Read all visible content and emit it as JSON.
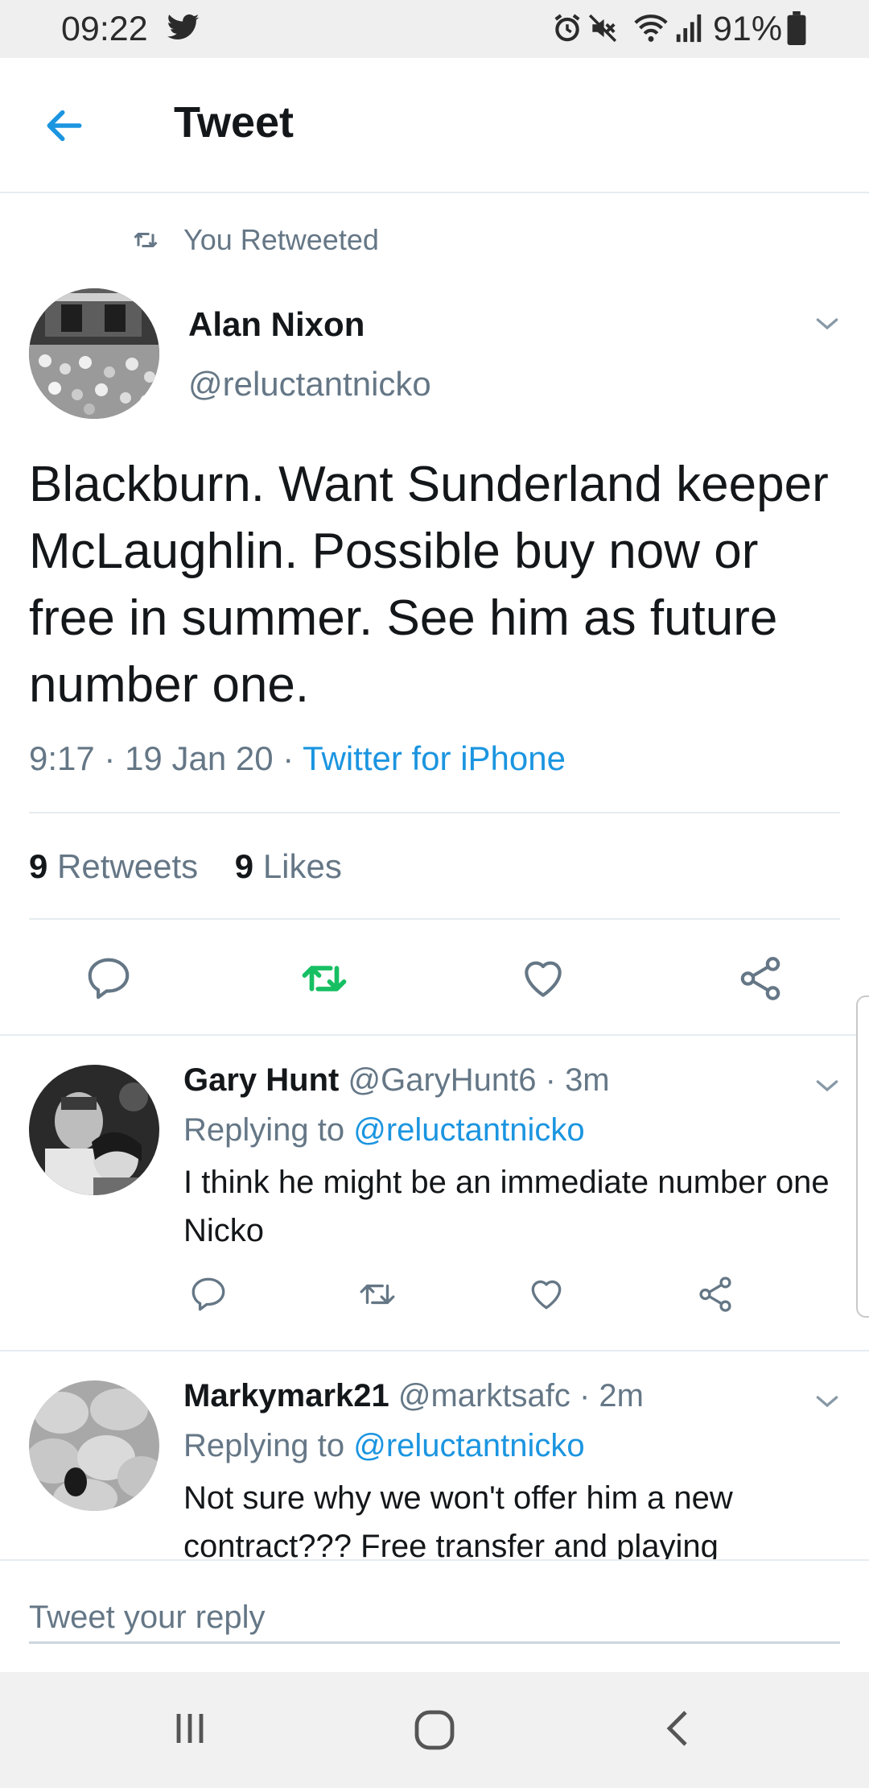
{
  "status_bar": {
    "time": "09:22",
    "battery": "91%",
    "icons": [
      "twitter-icon",
      "alarm-icon",
      "mute-icon",
      "wifi-icon",
      "signal-icon",
      "battery-icon"
    ]
  },
  "header": {
    "back_icon": "arrow-left-icon",
    "title": "Tweet"
  },
  "tweet": {
    "retweet_label": "You Retweeted",
    "author_name": "Alan Nixon",
    "author_handle": "@reluctantnicko",
    "text": "Blackburn. Want Sunderland keeper McLaughlin. Possible buy now or free in summer. See him as future number one.",
    "time": "9:17",
    "date": "19 Jan 20",
    "source": "Twitter for iPhone",
    "retweets_count": "9",
    "retweets_label": "Retweets",
    "likes_count": "9",
    "likes_label": "Likes",
    "retweeted": true
  },
  "replies": [
    {
      "name": "Gary Hunt",
      "handle": "@GaryHunt6",
      "age": "3m",
      "replying_prefix": "Replying to",
      "replying_to": "@reluctantnicko",
      "text": "I think he might be an immediate number one Nicko"
    },
    {
      "name": "Markymark21",
      "handle": "@marktsafc",
      "age": "2m",
      "replying_prefix": "Replying to",
      "replying_to": "@reluctantnicko",
      "text": "Not sure why we won't offer him a new contract??? Free transfer and playing"
    }
  ],
  "reply_bar": {
    "placeholder": "Tweet your reply"
  },
  "colors": {
    "accent": "#1b95e0",
    "retweet_active": "#17bf63",
    "secondary_text": "#657786",
    "divider": "#e6ecf0"
  }
}
